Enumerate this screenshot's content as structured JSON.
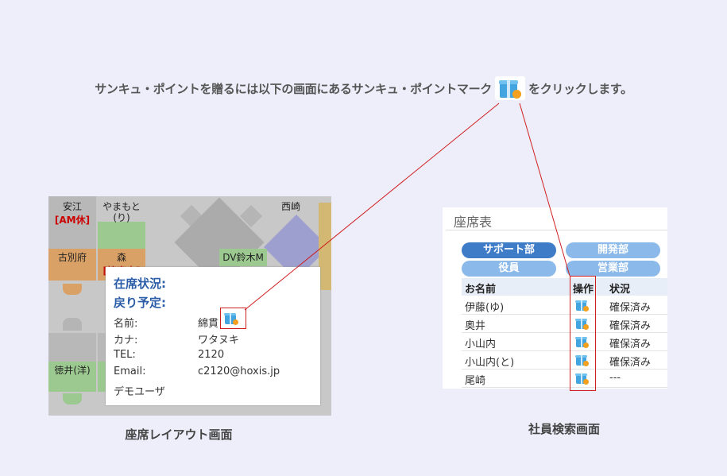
{
  "instruction": {
    "before": "サンキュ・ポイントを贈るには以下の画面にあるサンキュ・ポイントマーク",
    "after": "をクリックします。"
  },
  "seat_layout": {
    "caption": "座席レイアウト画面",
    "seats": {
      "yasue": "安江",
      "yasue_status": "[AM休]",
      "yamamoto": "やまもと",
      "yamamoto_sub": "(り)",
      "nishizaki": "西崎",
      "furubefu": "古別府",
      "mori": "森",
      "mori_status": "[接客中]",
      "dv_suzuki": "DV鈴木M",
      "tokui": "徳井(洋)"
    },
    "popup": {
      "presence": "在席状況:",
      "return": "戻り予定:",
      "name_label": "名前:",
      "name_value": "綿貫",
      "kana_label": "カナ:",
      "kana_value": "ワタヌキ",
      "tel_label": "TEL:",
      "tel_value": "2120",
      "email_label": "Email:",
      "email_value": "c2120@hoxis.jp",
      "group": "デモユーザ"
    }
  },
  "employee_search": {
    "caption": "社員検索画面",
    "title": "座席表",
    "tabs": [
      "サポート部",
      "開発部",
      "役員",
      "営業部"
    ],
    "columns": [
      "お名前",
      "操作",
      "状況"
    ],
    "rows": [
      {
        "name": "伊藤(ゆ)",
        "status": "確保済み"
      },
      {
        "name": "奥井",
        "status": "確保済み"
      },
      {
        "name": "小山内",
        "status": "確保済み"
      },
      {
        "name": "小山内(と)",
        "status": "確保済み"
      },
      {
        "name": "尾崎",
        "status": "---"
      }
    ]
  },
  "colors": {
    "accent": "#3f7cc8",
    "callout": "#d01f1f",
    "background": "#eeeefb"
  },
  "icons": {
    "thank_you_point": "gift-heart-icon"
  }
}
